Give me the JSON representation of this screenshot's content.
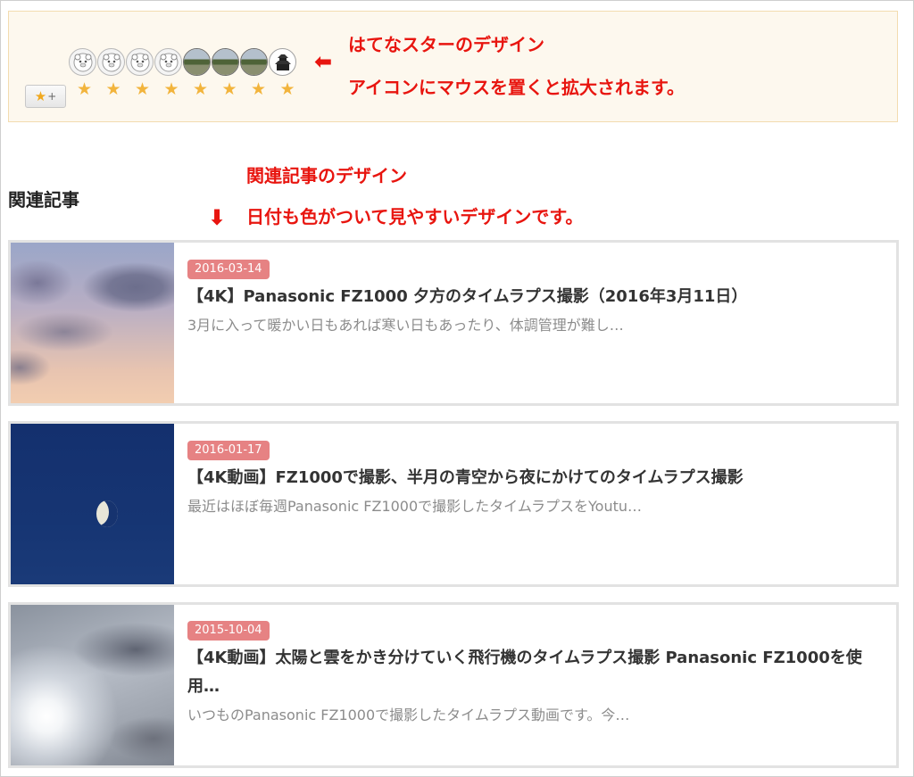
{
  "star_section": {
    "add_star_label": "+",
    "star_glyph": "★",
    "avatar_count": 8,
    "star_count": 8
  },
  "annotations": {
    "star_line1": "はてなスターのデザイン",
    "star_line2": "アイコンにマウスを置くと拡大されます。",
    "related_line1": "関連記事のデザイン",
    "related_line2": "日付も色がついて見やすいデザインです。",
    "arrow_left": "⬅",
    "arrow_down": "⬇"
  },
  "related": {
    "heading": "関連記事",
    "entries": [
      {
        "date": "2016-03-14",
        "title": "【4K】Panasonic FZ1000 夕方のタイムラプス撮影（2016年3月11日）",
        "desc": "3月に入って暖かい日もあれば寒い日もあったり、体調管理が難し…"
      },
      {
        "date": "2016-01-17",
        "title": "【4K動画】FZ1000で撮影、半月の青空から夜にかけてのタイムラプス撮影",
        "desc": "最近はほぼ毎週Panasonic FZ1000で撮影したタイムラプスをYoutu…"
      },
      {
        "date": "2015-10-04",
        "title": "【4K動画】太陽と雲をかき分けていく飛行機のタイムラプス撮影 Panasonic FZ1000を使用…",
        "desc": "いつものPanasonic FZ1000で撮影したタイムラプス動画です。今…"
      }
    ]
  },
  "colors": {
    "annotation_red": "#e8150f",
    "date_badge": "#e68283",
    "star_yellow": "#f2b43c"
  }
}
